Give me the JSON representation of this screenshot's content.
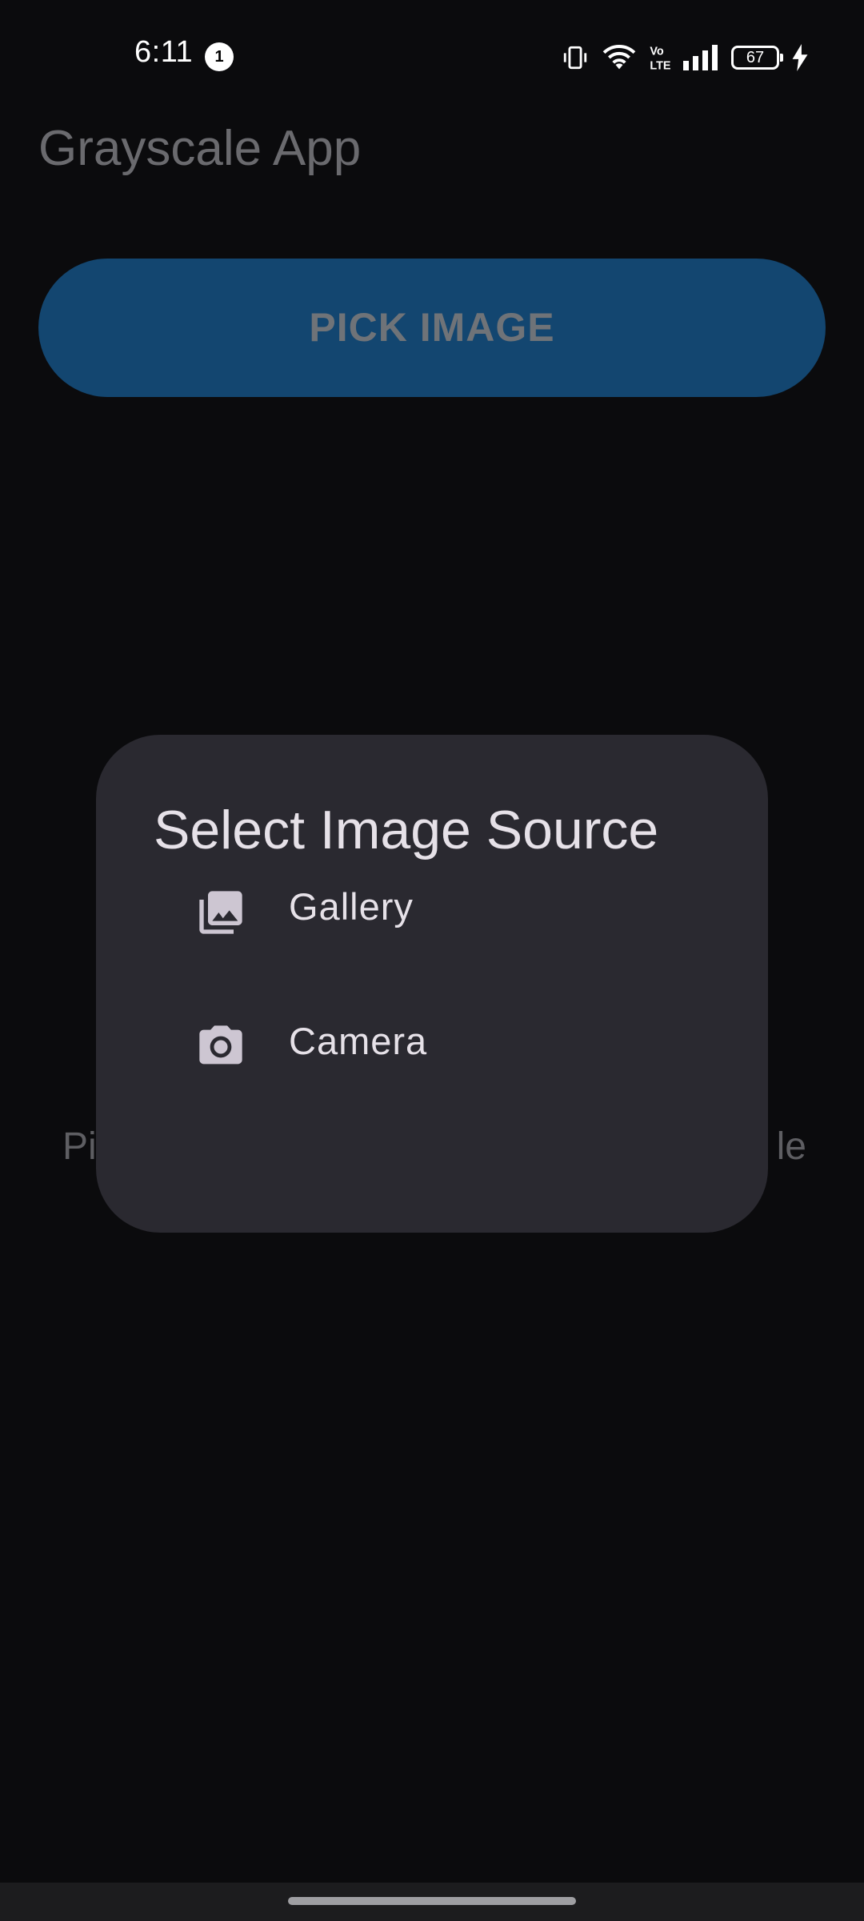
{
  "status_bar": {
    "time": "6:11",
    "notification_count": "1",
    "battery_level": "67",
    "icons": [
      "vibrate-icon",
      "wifi-icon",
      "volte-icon",
      "signal-icon",
      "battery-icon",
      "charging-icon"
    ]
  },
  "app": {
    "title": "Grayscale App",
    "pick_button_label": "PICK IMAGE",
    "hint_left_fragment": "Pi",
    "hint_right_fragment": "le"
  },
  "dialog": {
    "title": "Select Image Source",
    "options": [
      {
        "label": "Gallery",
        "icon": "gallery-icon"
      },
      {
        "label": "Camera",
        "icon": "camera-icon"
      }
    ]
  },
  "colors": {
    "background": "#0b0b0d",
    "dialog_surface": "#2a2930",
    "dialog_text": "#e6e1e8",
    "button_fill": "#134670"
  }
}
